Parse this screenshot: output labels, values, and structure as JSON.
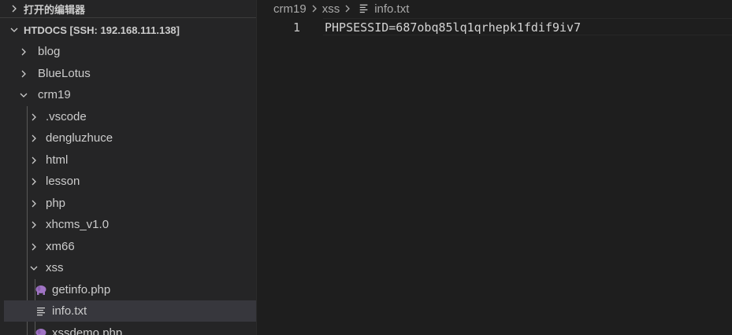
{
  "explorer": {
    "open_editors_label": "打开的编辑器",
    "workspace_label": "HTDOCS [SSH: 192.168.111.138]",
    "tree": [
      {
        "label": "blog",
        "kind": "folder",
        "expanded": false
      },
      {
        "label": "BlueLotus",
        "kind": "folder",
        "expanded": false
      },
      {
        "label": "crm19",
        "kind": "folder",
        "expanded": true
      },
      {
        "label": ".vscode",
        "kind": "folder",
        "expanded": false
      },
      {
        "label": "dengluzhuce",
        "kind": "folder",
        "expanded": false
      },
      {
        "label": "html",
        "kind": "folder",
        "expanded": false
      },
      {
        "label": "lesson",
        "kind": "folder",
        "expanded": false
      },
      {
        "label": "php",
        "kind": "folder",
        "expanded": false
      },
      {
        "label": "xhcms_v1.0",
        "kind": "folder",
        "expanded": false
      },
      {
        "label": "xm66",
        "kind": "folder",
        "expanded": false
      },
      {
        "label": "xss",
        "kind": "folder",
        "expanded": true
      },
      {
        "label": "getinfo.php",
        "kind": "php-file"
      },
      {
        "label": "info.txt",
        "kind": "txt-file",
        "selected": true
      },
      {
        "label": "xssdemo.php",
        "kind": "php-file"
      }
    ]
  },
  "editor": {
    "breadcrumb": [
      "crm19",
      "xss",
      "info.txt"
    ],
    "lines": [
      {
        "number": "1",
        "text": "PHPSESSID=687obq85lq1qrhepk1fdif9iv7"
      }
    ]
  },
  "colors": {
    "sidebar_bg": "#252526",
    "editor_bg": "#1e1e1e",
    "selected_row": "#37373d",
    "php_icon": "#a074c4"
  }
}
